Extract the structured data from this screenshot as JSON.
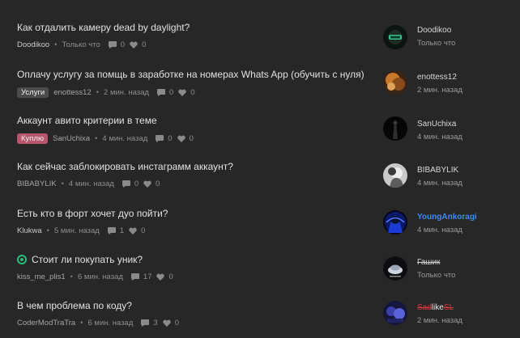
{
  "threads": [
    {
      "title": "Как отдалить камеру dead by daylight?",
      "prefix": "",
      "author": "Doodikoo",
      "time": "Только что",
      "replies": "0",
      "likes": "0",
      "last_user": "Doodikoo",
      "last_time": "Только что"
    },
    {
      "title": "Оплачу услугу за помщь в заработке на номерах Whats App (обучить с нуля)",
      "prefix": "Услуги",
      "author": "enottess12",
      "time": "2 мин. назад",
      "replies": "0",
      "likes": "0",
      "last_user": "enottess12",
      "last_time": "2 мин. назад"
    },
    {
      "title": "Аккаунт авито критерии в теме",
      "prefix": "Куплю",
      "author": "SanUchixa",
      "time": "4 мин. назад",
      "replies": "0",
      "likes": "0",
      "last_user": "SanUchixa",
      "last_time": "4 мин. назад"
    },
    {
      "title": "Как сейчас заблокировать инстаграмм аккаунт?",
      "prefix": "",
      "author": "BIBABYLIK",
      "time": "4 мин. назад",
      "replies": "0",
      "likes": "0",
      "last_user": "BIBABYLIK",
      "last_time": "4 мин. назад"
    },
    {
      "title": "Есть кто в форт хочет дуо пойти?",
      "prefix": "",
      "author": "Klukwa",
      "time": "5 мин. назад",
      "replies": "1",
      "likes": "0",
      "last_user": "YoungAnkoragi",
      "last_time": "4 мин. назад"
    },
    {
      "title": "Стоит ли покупать уник?",
      "prefix": "",
      "author": "kiss_me_plis1",
      "time": "6 мин. назад",
      "replies": "17",
      "likes": "0",
      "last_user": "Гашик",
      "last_time": "Только что"
    },
    {
      "title": "В чем проблема по коду?",
      "prefix": "",
      "author": "CoderModTraTra",
      "time": "6 мин. назад",
      "replies": "3",
      "likes": "0",
      "last_user_parts": [
        "Sad",
        "like",
        "SL"
      ],
      "last_time": "2 мин. назад"
    }
  ],
  "colors": {
    "background": "#272727",
    "prefix_services": "#4b4b4b",
    "prefix_buy": "#b7566d",
    "username_blue": "#3f8cf0",
    "unique_icon": "#22c07a"
  },
  "icons": {
    "replies": "speech-bubble-icon",
    "likes": "heart-icon",
    "unique": "target-icon"
  }
}
